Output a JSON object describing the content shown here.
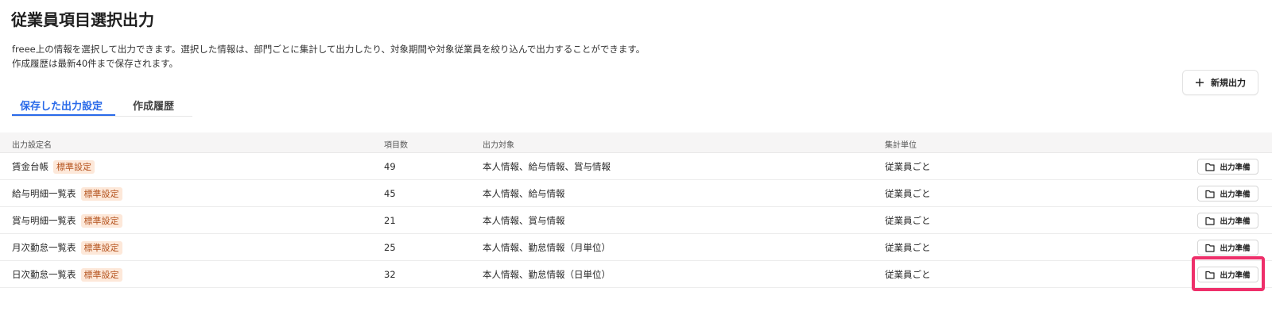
{
  "page": {
    "title": "従業員項目選択出力",
    "description_line1": "freee上の情報を選択して出力できます。選択した情報は、部門ごとに集計して出力したり、対象期間や対象従業員を絞り込んで出力することができます。",
    "description_line2": "作成履歴は最新40件まで保存されます。"
  },
  "toolbar": {
    "new_output_label": "新規出力"
  },
  "tabs": [
    {
      "label": "保存した出力設定",
      "active": true
    },
    {
      "label": "作成履歴",
      "active": false
    }
  ],
  "table": {
    "headers": {
      "name": "出力設定名",
      "count": "項目数",
      "target": "出力対象",
      "unit": "集計単位"
    },
    "rows": [
      {
        "name": "賃金台帳",
        "badge": "標準設定",
        "count": "49",
        "target": "本人情報、給与情報、賞与情報",
        "unit": "従業員ごと",
        "action": "出力準備"
      },
      {
        "name": "給与明細一覧表",
        "badge": "標準設定",
        "count": "45",
        "target": "本人情報、給与情報",
        "unit": "従業員ごと",
        "action": "出力準備"
      },
      {
        "name": "賞与明細一覧表",
        "badge": "標準設定",
        "count": "21",
        "target": "本人情報、賞与情報",
        "unit": "従業員ごと",
        "action": "出力準備"
      },
      {
        "name": "月次勤怠一覧表",
        "badge": "標準設定",
        "count": "25",
        "target": "本人情報、勤怠情報（月単位）",
        "unit": "従業員ごと",
        "action": "出力準備"
      },
      {
        "name": "日次勤怠一覧表",
        "badge": "標準設定",
        "count": "32",
        "target": "本人情報、勤怠情報（日単位）",
        "unit": "従業員ごと",
        "action": "出力準備"
      }
    ]
  },
  "colors": {
    "accent": "#2a6ae9",
    "badge_bg": "#fde8d9",
    "badge_text": "#b4521d",
    "highlight": "#ee2f6a"
  }
}
